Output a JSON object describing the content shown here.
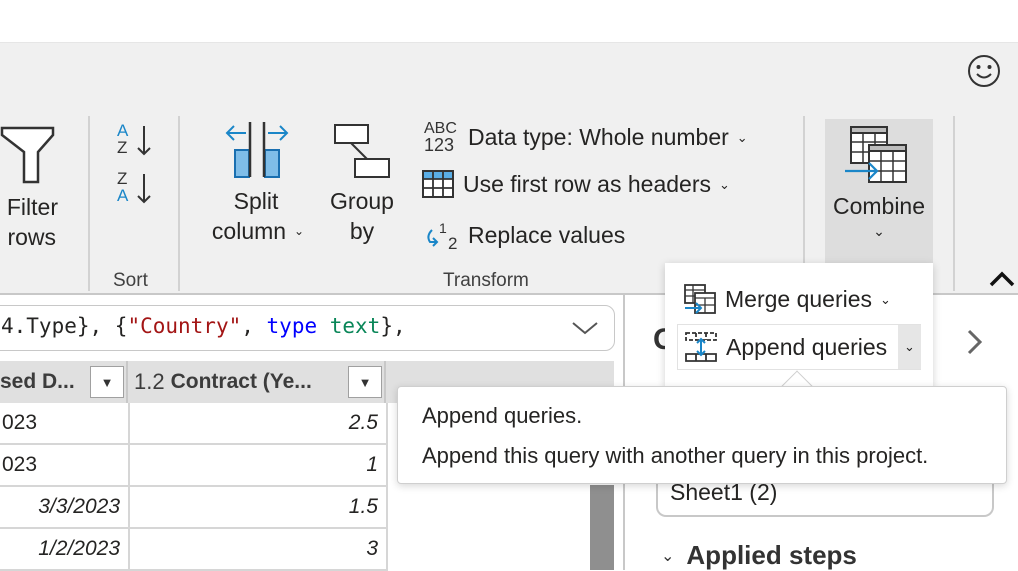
{
  "header": {
    "feedback_icon": "smiley-face-icon"
  },
  "ribbon": {
    "filter_rows": {
      "line1": "Filter",
      "line2": "rows",
      "icon": "funnel-icon"
    },
    "sort": {
      "group_label": "Sort",
      "ascending_icon": "sort-a-z-icon",
      "descending_icon": "sort-z-a-icon"
    },
    "split_column": {
      "line1": "Split",
      "line2": "column",
      "icon": "split-column-icon",
      "has_dropdown": true
    },
    "group_by": {
      "line1": "Group",
      "line2": "by",
      "icon": "group-by-icon"
    },
    "transform": {
      "group_label": "Transform",
      "data_type": {
        "label": "Data type: Whole number",
        "icon_top": "ABC",
        "icon_bottom": "123"
      },
      "use_first_row": {
        "label": "Use first row as headers"
      },
      "replace_values": {
        "label": "Replace values",
        "icon": "replace-values-icon"
      }
    },
    "combine": {
      "label": "Combine",
      "icon": "combine-tables-icon",
      "chevron": "⌄"
    },
    "collapse_icon": "chevron-up-icon"
  },
  "formula_bar": {
    "tokens": [
      {
        "text": "4.Type}, {",
        "kind": "default"
      },
      {
        "text": "\"Country\"",
        "kind": "string"
      },
      {
        "text": ", ",
        "kind": "default"
      },
      {
        "text": "type",
        "kind": "keyword"
      },
      {
        "text": " text",
        "kind": "type"
      },
      {
        "text": "},",
        "kind": "default"
      }
    ],
    "expand_icon": "chevron-down-icon"
  },
  "table": {
    "columns": [
      {
        "label": "sed D...",
        "type_icon": ""
      },
      {
        "label": "Contract (Ye...",
        "type_icon": "1.2"
      }
    ],
    "rows": [
      [
        "023",
        "2.5"
      ],
      [
        "023",
        "1"
      ],
      [
        "3/3/2023",
        "1.5"
      ],
      [
        "1/2/2023",
        "3"
      ]
    ]
  },
  "combine_menu": {
    "items": [
      {
        "label": "Merge queries",
        "icon": "merge-queries-icon"
      },
      {
        "label": "Append queries",
        "icon": "append-queries-icon"
      }
    ]
  },
  "tooltip": {
    "title": "Append queries.",
    "description": "Append this query with another query in this project."
  },
  "right_pane": {
    "heading_partial": "G",
    "next_icon": "chevron-right-icon",
    "query_name": "Sheet1 (2)",
    "applied_steps_label": "Applied steps"
  }
}
